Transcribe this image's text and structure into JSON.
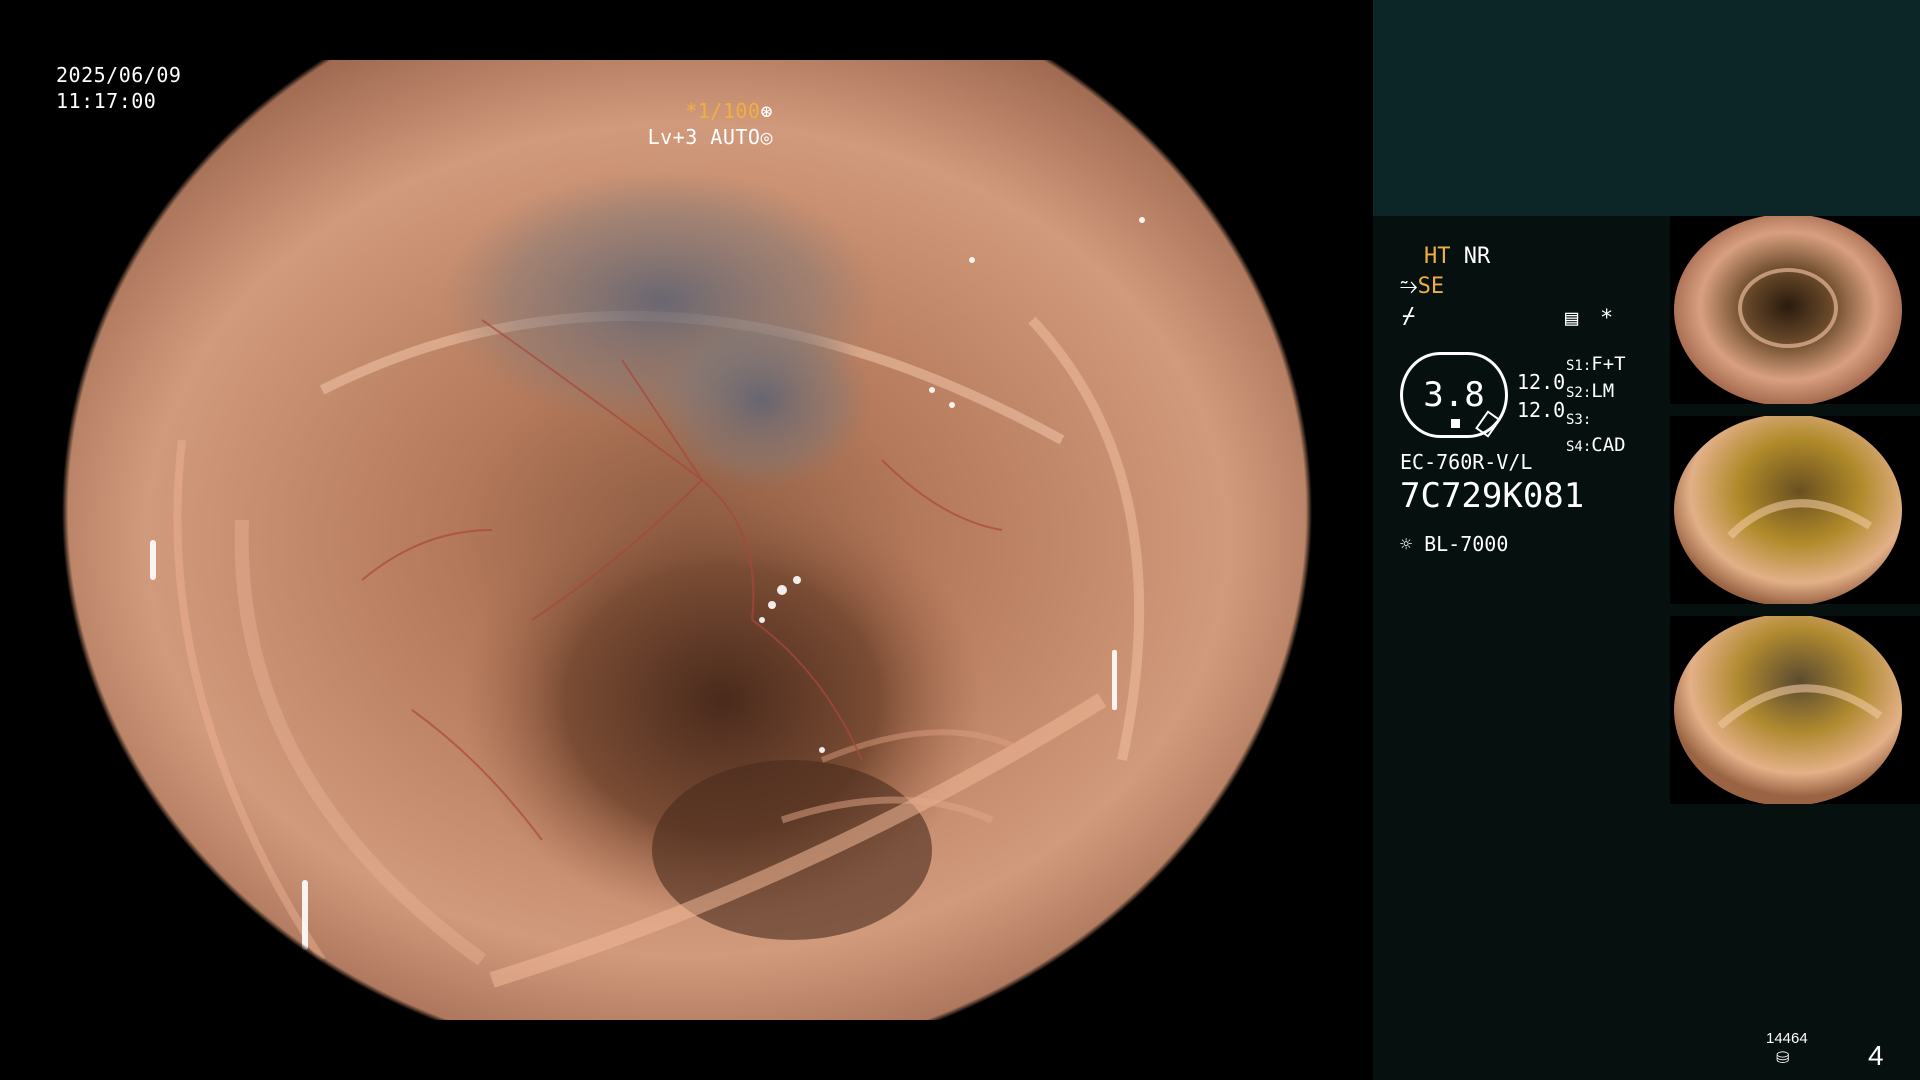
{
  "overlay": {
    "date": "2025/06/09",
    "time": "11:17:00",
    "shutter": "*1/100",
    "level": "Lv+3 AUTO"
  },
  "panel": {
    "ht": "HT",
    "nr": "NR",
    "se": "SE",
    "gauge_value": "3.8",
    "gauge_top": "12.0",
    "gauge_bottom": "12.0",
    "s1_label": "S1:",
    "s1_value": "F+T",
    "s2_label": "S2:",
    "s2_value": "LM",
    "s3_label": "S3:",
    "s3_value": "",
    "s4_label": "S4:",
    "s4_value": "CAD",
    "scope_model": "EC-760R-V/L",
    "serial": "7C729K081",
    "light_source": "BL-7000",
    "asterisk": "*",
    "record_count": "14464",
    "page_number": "4"
  },
  "colors": {
    "accent_orange": "#f0b040",
    "panel_bg": "#06100f",
    "panel_top_bg": "#0c2627",
    "mucosa": "#c88a6c"
  },
  "icons": [
    "shutter-icon",
    "auto-iris-icon",
    "scope-bend-icon",
    "lightning-icon",
    "settings-menu-icon",
    "light-source-icon",
    "storage-icon"
  ],
  "thumbnails": [
    {
      "name": "capture-1"
    },
    {
      "name": "capture-2"
    },
    {
      "name": "capture-3"
    }
  ]
}
